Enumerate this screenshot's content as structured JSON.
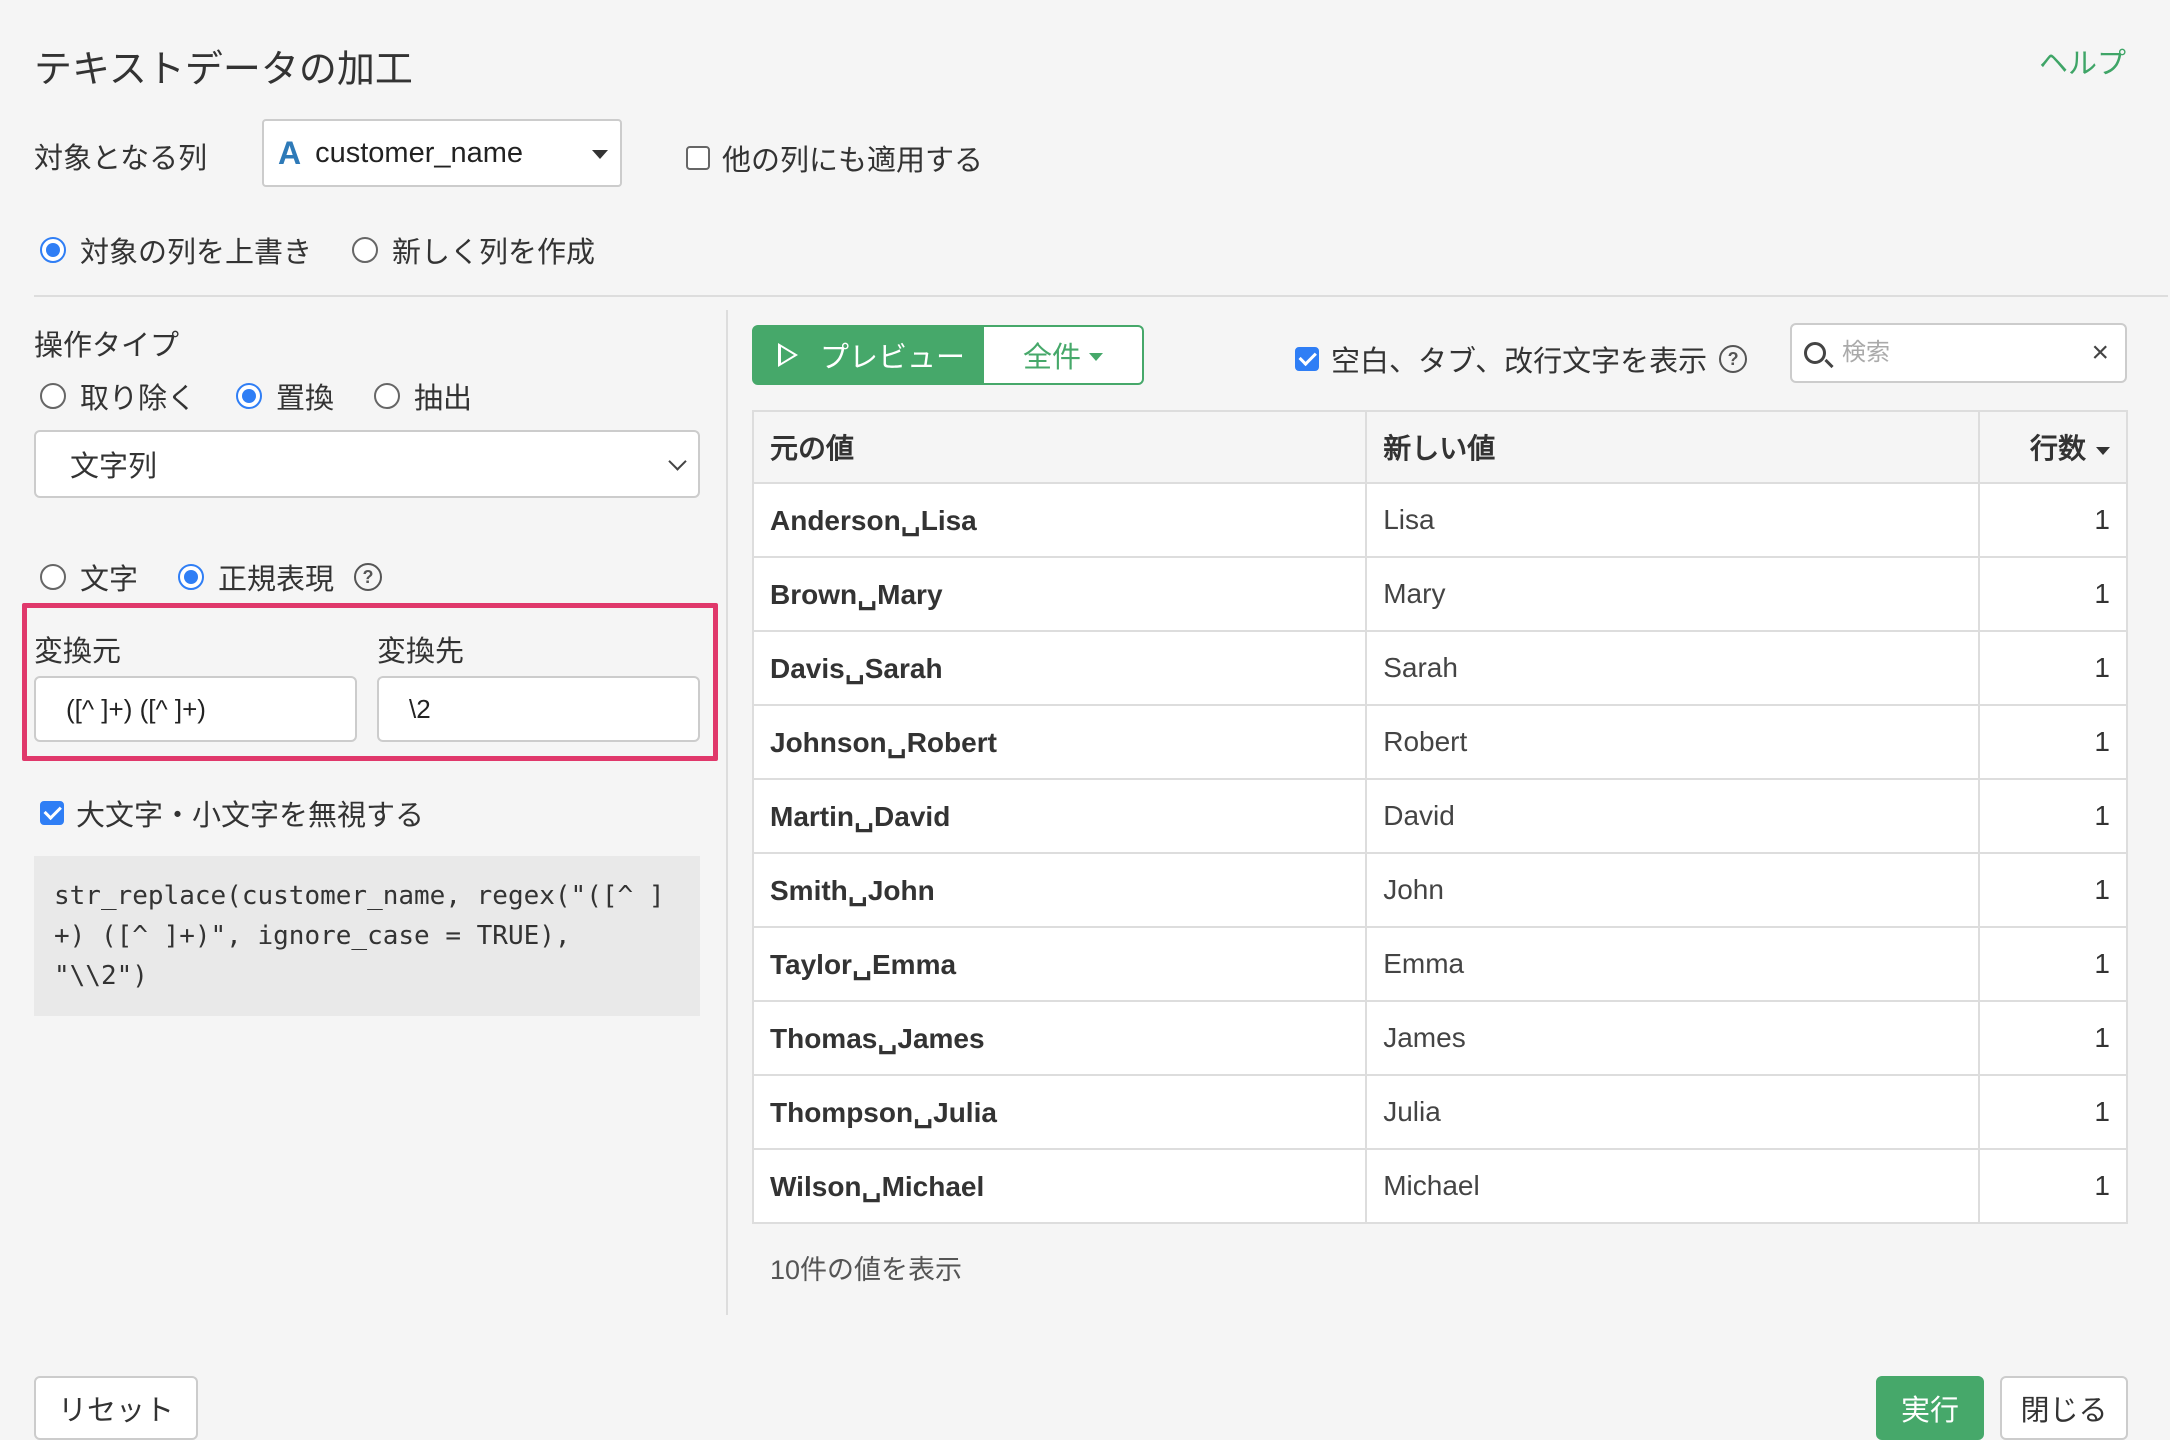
{
  "dialog": {
    "title": "テキストデータの加工",
    "help": "ヘルプ"
  },
  "target": {
    "label": "対象となる列",
    "type_glyph": "A",
    "column": "customer_name",
    "apply_other": "他の列にも適用する"
  },
  "mode": {
    "overwrite": "対象の列を上書き",
    "new_column": "新しく列を作成"
  },
  "operation": {
    "label": "操作タイプ",
    "remove": "取り除く",
    "replace": "置換",
    "extract": "抽出",
    "target_select": "文字列",
    "char": "文字",
    "regex": "正規表現",
    "help_glyph": "?"
  },
  "replace": {
    "from_label": "変換元",
    "from_value": "([^ ]+) ([^ ]+)",
    "to_label": "変換先",
    "to_value": "\\2"
  },
  "ignore_case": "大文字・小文字を無視する",
  "code": "str_replace(customer_name, regex(\"([^ ]+) ([^ ]+)\", ignore_case = TRUE), \"\\\\2\")",
  "toolbar": {
    "preview": "プレビュー",
    "all": "全件",
    "show_whitespace": "空白、タブ、改行文字を表示",
    "search_placeholder": "検索",
    "close_glyph": "×"
  },
  "table": {
    "headers": [
      "元の値",
      "新しい値",
      "行数"
    ],
    "rows": [
      [
        "Anderson␣Lisa",
        "Lisa",
        "1"
      ],
      [
        "Brown␣Mary",
        "Mary",
        "1"
      ],
      [
        "Davis␣Sarah",
        "Sarah",
        "1"
      ],
      [
        "Johnson␣Robert",
        "Robert",
        "1"
      ],
      [
        "Martin␣David",
        "David",
        "1"
      ],
      [
        "Smith␣John",
        "John",
        "1"
      ],
      [
        "Taylor␣Emma",
        "Emma",
        "1"
      ],
      [
        "Thomas␣James",
        "James",
        "1"
      ],
      [
        "Thompson␣Julia",
        "Julia",
        "1"
      ],
      [
        "Wilson␣Michael",
        "Michael",
        "1"
      ]
    ]
  },
  "count_text": "10件の値を表示",
  "footer": {
    "reset": "リセット",
    "run": "実行",
    "close": "閉じる"
  },
  "colors": {
    "accent_green": "#46a86a",
    "accent_blue": "#2f7ef5",
    "highlight": "#e0386b"
  }
}
